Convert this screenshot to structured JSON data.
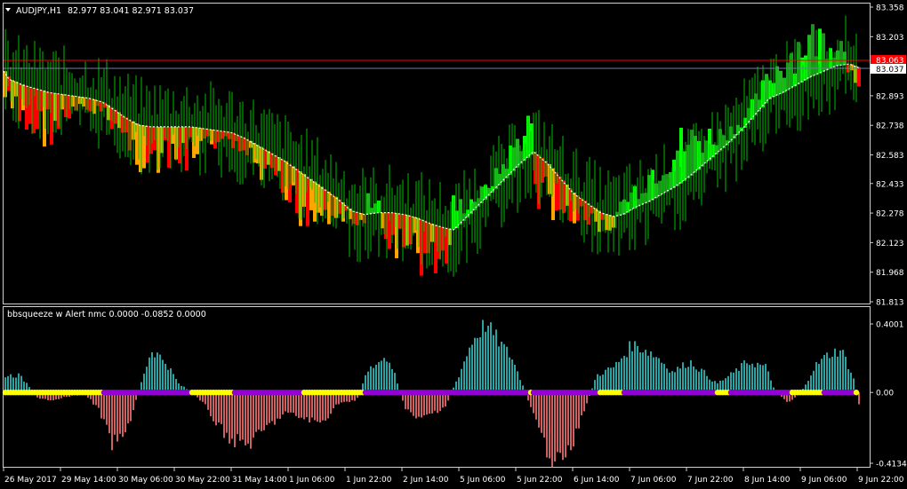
{
  "main": {
    "symbol_title": "AUDJPY,H1",
    "ohlc": "82.977 83.041 82.971 83.037",
    "y_ticks": [
      "83.358",
      "83.203",
      "82.893",
      "82.738",
      "82.583",
      "82.433",
      "82.278",
      "82.123",
      "81.968",
      "81.813"
    ],
    "ask_price_label": "83.063",
    "bid_price_label": "83.037",
    "bull_colors": [
      "#1f8f1f",
      "#22b622",
      "#00ff00"
    ],
    "bear_colors": [
      "#ff0000",
      "#ffa500"
    ],
    "candle_color": "#00c000",
    "ask_line_color": "#ff0000",
    "bid_line_color": "#6f7f9f"
  },
  "indicator": {
    "title": "bbsqueeze w Alert nmc 0.0000 -0.0852 0.0000",
    "y_ticks": [
      "0.4001",
      "0.00",
      "-0.4134"
    ],
    "positive_color": "#2ba3a3",
    "negative_color": "#cd6060",
    "squeeze_off_color": "#ffff00",
    "squeeze_on_color": "#9400d3"
  },
  "time_axis": {
    "labels": [
      "26 May 2017",
      "29 May 14:00",
      "30 May 06:00",
      "30 May 22:00",
      "31 May 14:00",
      "1 Jun 06:00",
      "1 Jun 22:00",
      "2 Jun 14:00",
      "5 Jun 06:00",
      "5 Jun 22:00",
      "6 Jun 14:00",
      "7 Jun 06:00",
      "7 Jun 22:00",
      "8 Jun 14:00",
      "9 Jun 06:00",
      "9 Jun 22:00"
    ]
  },
  "chart_data": {
    "type": "line",
    "title": "AUDJPY,H1",
    "price_path": [
      [
        0,
        83.05
      ],
      [
        10,
        82.98
      ],
      [
        25,
        82.95
      ],
      [
        40,
        82.93
      ],
      [
        55,
        82.91
      ],
      [
        70,
        82.9
      ],
      [
        85,
        82.89
      ],
      [
        100,
        82.88
      ],
      [
        115,
        82.86
      ],
      [
        125,
        82.83
      ],
      [
        140,
        82.78
      ],
      [
        155,
        82.74
      ],
      [
        170,
        82.73
      ],
      [
        185,
        82.73
      ],
      [
        200,
        82.73
      ],
      [
        215,
        82.73
      ],
      [
        230,
        82.72
      ],
      [
        245,
        82.71
      ],
      [
        260,
        82.7
      ],
      [
        275,
        82.67
      ],
      [
        290,
        82.63
      ],
      [
        305,
        82.59
      ],
      [
        320,
        82.55
      ],
      [
        335,
        82.5
      ],
      [
        350,
        82.45
      ],
      [
        365,
        82.4
      ],
      [
        380,
        82.35
      ],
      [
        395,
        82.29
      ],
      [
        410,
        82.27
      ],
      [
        425,
        82.28
      ],
      [
        440,
        82.28
      ],
      [
        455,
        82.27
      ],
      [
        470,
        82.25
      ],
      [
        485,
        82.22
      ],
      [
        500,
        82.2
      ],
      [
        510,
        82.19
      ],
      [
        525,
        82.26
      ],
      [
        540,
        82.33
      ],
      [
        555,
        82.4
      ],
      [
        570,
        82.47
      ],
      [
        585,
        82.54
      ],
      [
        600,
        82.6
      ],
      [
        615,
        82.54
      ],
      [
        630,
        82.46
      ],
      [
        645,
        82.38
      ],
      [
        660,
        82.33
      ],
      [
        675,
        82.28
      ],
      [
        690,
        82.26
      ],
      [
        700,
        82.27
      ],
      [
        715,
        82.31
      ],
      [
        730,
        82.34
      ],
      [
        745,
        82.38
      ],
      [
        760,
        82.42
      ],
      [
        775,
        82.47
      ],
      [
        790,
        82.53
      ],
      [
        805,
        82.59
      ],
      [
        820,
        82.65
      ],
      [
        835,
        82.72
      ],
      [
        850,
        82.8
      ],
      [
        865,
        82.88
      ],
      [
        880,
        82.91
      ],
      [
        895,
        82.95
      ],
      [
        910,
        82.99
      ],
      [
        925,
        83.02
      ],
      [
        940,
        83.05
      ],
      [
        955,
        83.06
      ],
      [
        966,
        83.04
      ]
    ],
    "indicator_histogram_envelope": [
      [
        0,
        0.1
      ],
      [
        20,
        0.1
      ],
      [
        30,
        0.05
      ],
      [
        42,
        -0.04
      ],
      [
        60,
        -0.04
      ],
      [
        80,
        -0.02
      ],
      [
        95,
        -0.01
      ],
      [
        110,
        -0.1
      ],
      [
        125,
        -0.3
      ],
      [
        140,
        -0.25
      ],
      [
        150,
        -0.08
      ],
      [
        160,
        0.1
      ],
      [
        170,
        0.25
      ],
      [
        185,
        0.18
      ],
      [
        200,
        0.05
      ],
      [
        215,
        0.0
      ],
      [
        230,
        -0.08
      ],
      [
        245,
        -0.2
      ],
      [
        260,
        -0.28
      ],
      [
        280,
        -0.3
      ],
      [
        300,
        -0.2
      ],
      [
        320,
        -0.12
      ],
      [
        340,
        -0.15
      ],
      [
        360,
        -0.18
      ],
      [
        380,
        -0.06
      ],
      [
        400,
        -0.05
      ],
      [
        410,
        0.1
      ],
      [
        425,
        0.2
      ],
      [
        440,
        0.15
      ],
      [
        455,
        -0.1
      ],
      [
        470,
        -0.16
      ],
      [
        485,
        -0.12
      ],
      [
        500,
        -0.08
      ],
      [
        515,
        0.1
      ],
      [
        530,
        0.3
      ],
      [
        545,
        0.4
      ],
      [
        560,
        0.3
      ],
      [
        575,
        0.2
      ],
      [
        590,
        0.0
      ],
      [
        600,
        -0.15
      ],
      [
        615,
        -0.35
      ],
      [
        625,
        -0.41
      ],
      [
        640,
        -0.35
      ],
      [
        655,
        -0.12
      ],
      [
        670,
        0.1
      ],
      [
        690,
        0.15
      ],
      [
        710,
        0.28
      ],
      [
        725,
        0.25
      ],
      [
        740,
        0.2
      ],
      [
        755,
        0.12
      ],
      [
        775,
        0.18
      ],
      [
        790,
        0.12
      ],
      [
        805,
        0.05
      ],
      [
        820,
        0.1
      ],
      [
        840,
        0.18
      ],
      [
        860,
        0.15
      ],
      [
        870,
        0.02
      ],
      [
        885,
        -0.06
      ],
      [
        900,
        0.0
      ],
      [
        915,
        0.15
      ],
      [
        930,
        0.22
      ],
      [
        945,
        0.25
      ],
      [
        958,
        0.1
      ],
      [
        966,
        -0.09
      ]
    ],
    "xlabel": "",
    "ylabel": ""
  }
}
